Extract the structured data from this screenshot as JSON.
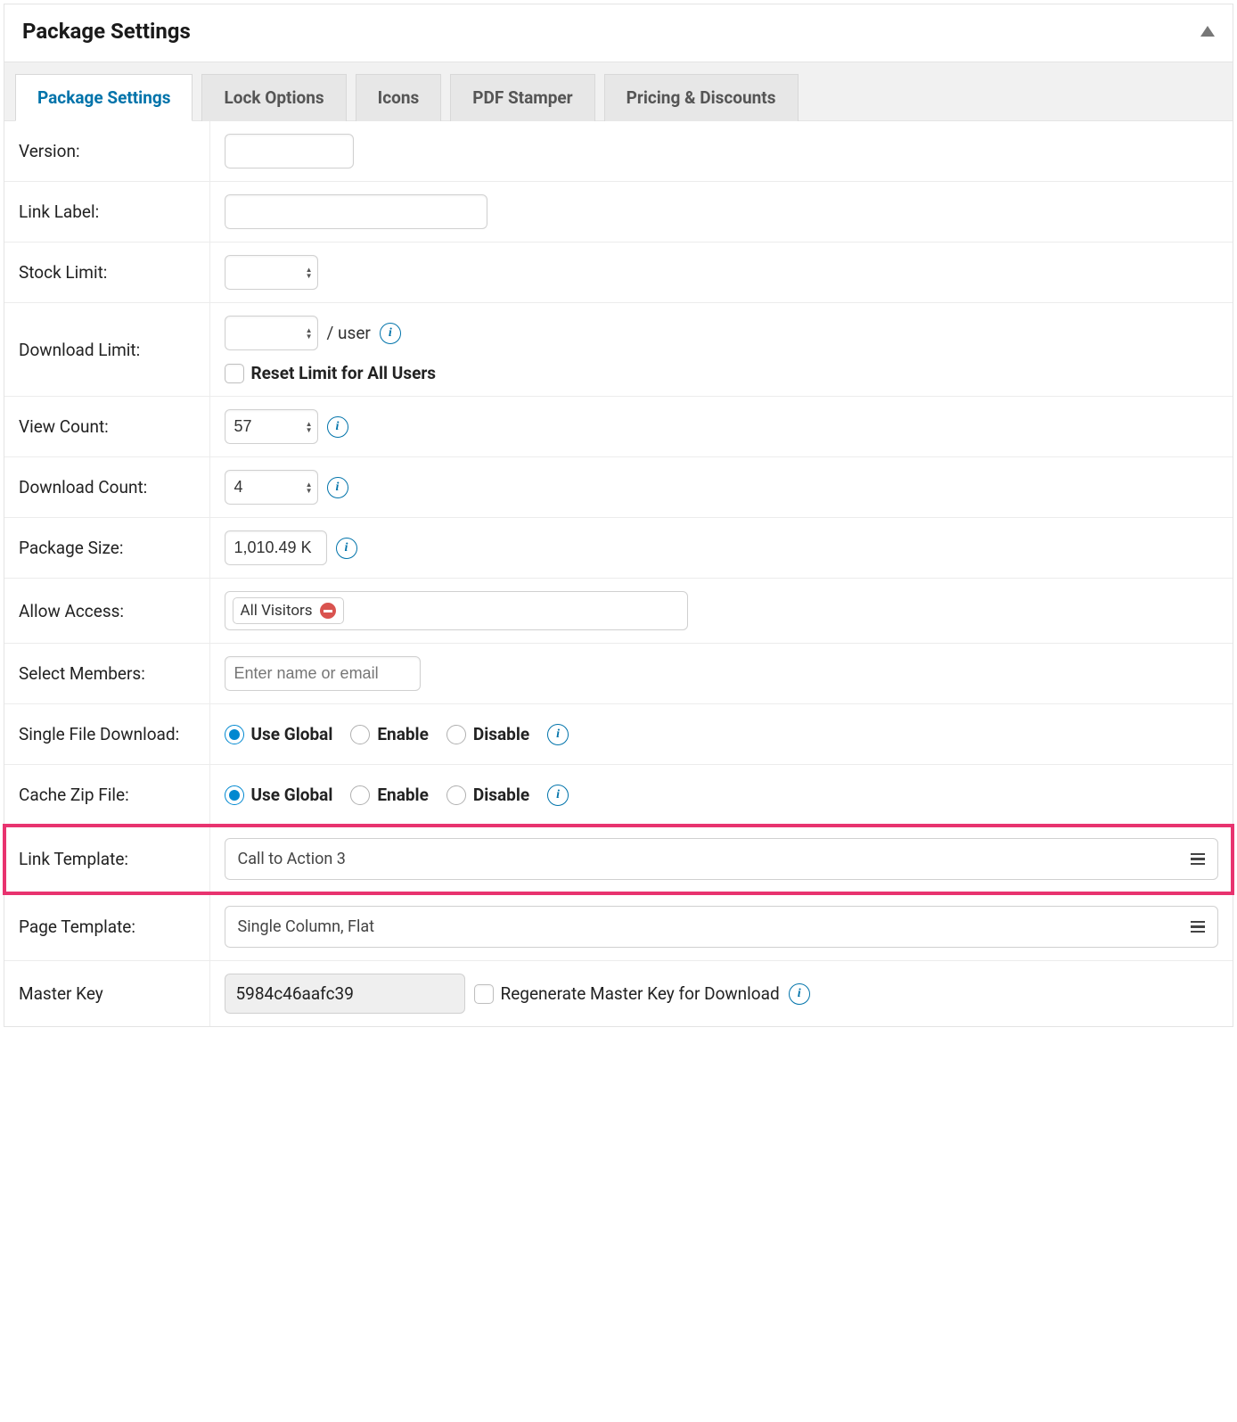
{
  "panel": {
    "title": "Package Settings"
  },
  "tabs": [
    {
      "label": "Package Settings",
      "active": true
    },
    {
      "label": "Lock Options",
      "active": false
    },
    {
      "label": "Icons",
      "active": false
    },
    {
      "label": "PDF Stamper",
      "active": false
    },
    {
      "label": "Pricing & Discounts",
      "active": false
    }
  ],
  "rows": {
    "version": {
      "label": "Version:",
      "value": ""
    },
    "link_label": {
      "label": "Link Label:",
      "value": ""
    },
    "stock_limit": {
      "label": "Stock Limit:",
      "value": ""
    },
    "download_limit": {
      "label": "Download Limit:",
      "value": "",
      "suffix": "/ user",
      "reset_label": "Reset Limit for All Users"
    },
    "view_count": {
      "label": "View Count:",
      "value": "57"
    },
    "download_count": {
      "label": "Download Count:",
      "value": "4"
    },
    "package_size": {
      "label": "Package Size:",
      "value": "1,010.49 K"
    },
    "allow_access": {
      "label": "Allow Access:",
      "chip": "All Visitors"
    },
    "select_members": {
      "label": "Select Members:",
      "placeholder": "Enter name or email"
    },
    "single_file_download": {
      "label": "Single File Download:",
      "options": [
        "Use Global",
        "Enable",
        "Disable"
      ],
      "selected": "Use Global"
    },
    "cache_zip": {
      "label": "Cache Zip File:",
      "options": [
        "Use Global",
        "Enable",
        "Disable"
      ],
      "selected": "Use Global"
    },
    "link_template": {
      "label": "Link Template:",
      "value": "Call to Action 3"
    },
    "page_template": {
      "label": "Page Template:",
      "value": "Single Column, Flat"
    },
    "master_key": {
      "label": "Master Key",
      "value": "5984c46aafc39",
      "regen_label": "Regenerate Master Key for Download"
    }
  }
}
